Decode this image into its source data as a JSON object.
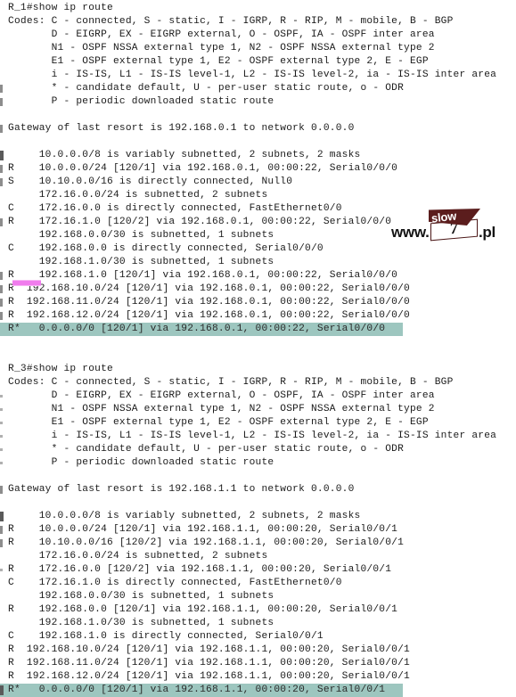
{
  "theme": {
    "background": "#ffffff",
    "text_color": "#1b1b1b",
    "highlight_bg": "#9dc6bf",
    "marker_pink": "#f07ced",
    "watermark_maroon": "#5b1d1d"
  },
  "watermark": {
    "prefix": "www.",
    "flag_label": "slow",
    "number": "7",
    "suffix": ".pl"
  },
  "blocks": [
    {
      "name": "r1-show-ip-route",
      "prompt": "R_1#show ip route",
      "gateway": "Gateway of last resort is 192.168.0.1 to network 0.0.0.0",
      "codes": [
        "Codes: C - connected, S - static, I - IGRP, R - RIP, M - mobile, B - BGP",
        "       D - EIGRP, EX - EIGRP external, O - OSPF, IA - OSPF inter area",
        "       N1 - OSPF NSSA external type 1, N2 - OSPF NSSA external type 2",
        "       E1 - OSPF external type 1, E2 - OSPF external type 2, E - EGP",
        "       i - IS-IS, L1 - IS-IS level-1, L2 - IS-IS level-2, ia - IS-IS inter area",
        "       * - candidate default, U - per-user static route, o - ODR",
        "       P - periodic downloaded static route"
      ],
      "routes": [
        {
          "text": "     10.0.0.0/8 is variably subnetted, 2 subnets, 2 masks",
          "highlight": false,
          "tick": "dark"
        },
        {
          "text": "R    10.0.0.0/24 [120/1] via 192.168.0.1, 00:00:22, Serial0/0/0",
          "highlight": false,
          "tick": "normal"
        },
        {
          "text": "S    10.10.0.0/16 is directly connected, Null0",
          "highlight": false,
          "tick": "normal"
        },
        {
          "text": "     172.16.0.0/24 is subnetted, 2 subnets",
          "highlight": false,
          "tick": "none"
        },
        {
          "text": "C    172.16.0.0 is directly connected, FastEthernet0/0",
          "highlight": false,
          "tick": "none"
        },
        {
          "text": "R    172.16.1.0 [120/2] via 192.168.0.1, 00:00:22, Serial0/0/0",
          "highlight": false,
          "tick": "normal"
        },
        {
          "text": "     192.168.0.0/30 is subnetted, 1 subnets",
          "highlight": false,
          "tick": "none"
        },
        {
          "text": "C    192.168.0.0 is directly connected, Serial0/0/0",
          "highlight": false,
          "tick": "none"
        },
        {
          "text": "     192.168.1.0/30 is subnetted, 1 subnets",
          "highlight": false,
          "tick": "none"
        },
        {
          "text": "R    192.168.1.0 [120/1] via 192.168.0.1, 00:00:22, Serial0/0/0",
          "highlight": false,
          "tick": "normal"
        },
        {
          "text": "R  192.168.10.0/24 [120/1] via 192.168.0.1, 00:00:22, Serial0/0/0",
          "highlight": false,
          "tick": "normal"
        },
        {
          "text": "R  192.168.11.0/24 [120/1] via 192.168.0.1, 00:00:22, Serial0/0/0",
          "highlight": false,
          "tick": "normal"
        },
        {
          "text": "R  192.168.12.0/24 [120/1] via 192.168.0.1, 00:00:22, Serial0/0/0",
          "highlight": false,
          "tick": "normal"
        },
        {
          "text": "R*   0.0.0.0/0 [120/1] via 192.168.0.1, 00:00:22, Serial0/0/0",
          "highlight": true,
          "tick": "none"
        }
      ]
    },
    {
      "name": "r3-show-ip-route",
      "prompt": "R_3#show ip route",
      "gateway": "Gateway of last resort is 192.168.1.1 to network 0.0.0.0",
      "codes": [
        "Codes: C - connected, S - static, I - IGRP, R - RIP, M - mobile, B - BGP",
        "       D - EIGRP, EX - EIGRP external, O - OSPF, IA - OSPF inter area",
        "       N1 - OSPF NSSA external type 1, N2 - OSPF NSSA external type 2",
        "       E1 - OSPF external type 1, E2 - OSPF external type 2, E - EGP",
        "       i - IS-IS, L1 - IS-IS level-1, L2 - IS-IS level-2, ia - IS-IS inter area",
        "       * - candidate default, U - per-user static route, o - ODR",
        "       P - periodic downloaded static route"
      ],
      "routes": [
        {
          "text": "     10.0.0.0/8 is variably subnetted, 2 subnets, 2 masks",
          "highlight": false,
          "tick": "dark"
        },
        {
          "text": "R    10.0.0.0/24 [120/1] via 192.168.1.1, 00:00:20, Serial0/0/1",
          "highlight": false,
          "tick": "normal"
        },
        {
          "text": "R    10.10.0.0/16 [120/2] via 192.168.1.1, 00:00:20, Serial0/0/1",
          "highlight": false,
          "tick": "normal"
        },
        {
          "text": "     172.16.0.0/24 is subnetted, 2 subnets",
          "highlight": false,
          "tick": "none"
        },
        {
          "text": "R    172.16.0.0 [120/2] via 192.168.1.1, 00:00:20, Serial0/0/1",
          "highlight": false,
          "tick": "faint"
        },
        {
          "text": "C    172.16.1.0 is directly connected, FastEthernet0/0",
          "highlight": false,
          "tick": "none"
        },
        {
          "text": "     192.168.0.0/30 is subnetted, 1 subnets",
          "highlight": false,
          "tick": "none"
        },
        {
          "text": "R    192.168.0.0 [120/1] via 192.168.1.1, 00:00:20, Serial0/0/1",
          "highlight": false,
          "tick": "none"
        },
        {
          "text": "     192.168.1.0/30 is subnetted, 1 subnets",
          "highlight": false,
          "tick": "none"
        },
        {
          "text": "C    192.168.1.0 is directly connected, Serial0/0/1",
          "highlight": false,
          "tick": "none"
        },
        {
          "text": "R  192.168.10.0/24 [120/1] via 192.168.1.1, 00:00:20, Serial0/0/1",
          "highlight": false,
          "tick": "none"
        },
        {
          "text": "R  192.168.11.0/24 [120/1] via 192.168.1.1, 00:00:20, Serial0/0/1",
          "highlight": false,
          "tick": "none"
        },
        {
          "text": "R  192.168.12.0/24 [120/1] via 192.168.1.1, 00:00:20, Serial0/0/1",
          "highlight": false,
          "tick": "none"
        },
        {
          "text": "R*   0.0.0.0/0 [120/1] via 192.168.1.1, 00:00:20, Serial0/0/1",
          "highlight": true,
          "tick": "dark"
        }
      ]
    }
  ]
}
